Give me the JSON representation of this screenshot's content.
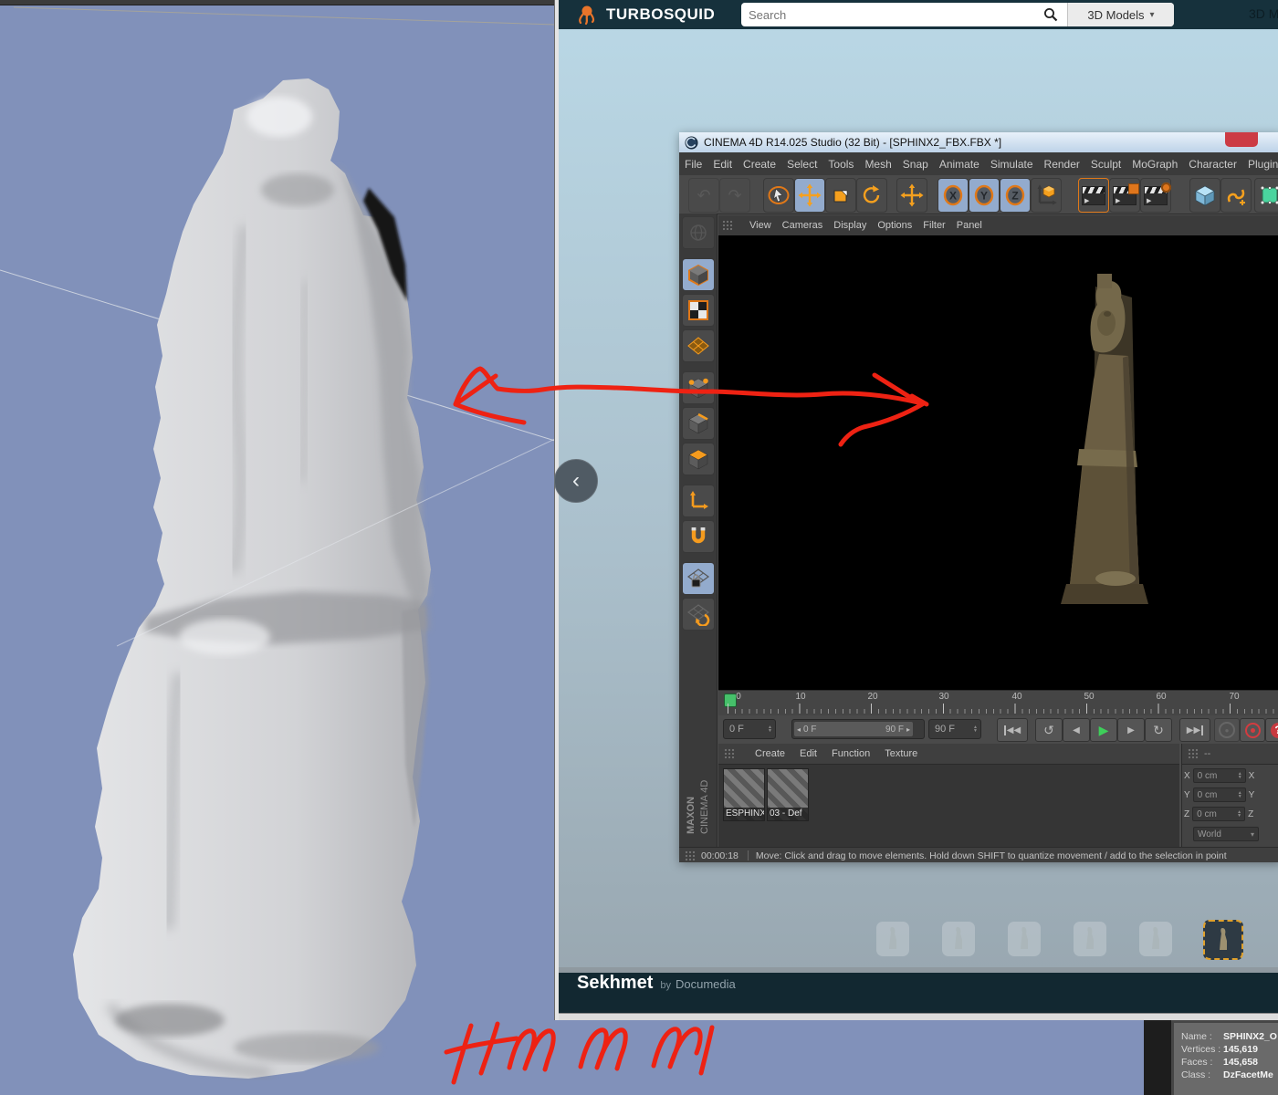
{
  "turbosquid": {
    "brand": "TURBOSQUID",
    "search_placeholder": "Search",
    "models_dropdown": "3D Models",
    "nav_right": "3D M",
    "footer": {
      "title": "Sekhmet",
      "by": "by",
      "author": "Documedia"
    }
  },
  "cinema4d": {
    "window_title": "CINEMA 4D R14.025 Studio (32 Bit) - [SPHINX2_FBX.FBX *]",
    "menu_items": [
      "File",
      "Edit",
      "Create",
      "Select",
      "Tools",
      "Mesh",
      "Snap",
      "Animate",
      "Simulate",
      "Render",
      "Sculpt",
      "MoGraph",
      "Character",
      "Plugins"
    ],
    "viewport_menu_items": [
      "View",
      "Cameras",
      "Display",
      "Options",
      "Filter",
      "Panel"
    ],
    "timeline": {
      "ticks": [
        "0",
        "10",
        "20",
        "30",
        "40",
        "50",
        "60",
        "70"
      ]
    },
    "transport": {
      "current_frame": "0 F",
      "range_start": "0 F",
      "range_end": "90 F",
      "end_frame": "90 F"
    },
    "materials": {
      "menu_items": [
        "Create",
        "Edit",
        "Function",
        "Texture"
      ],
      "items": [
        "ESPHINX",
        "03 - Def"
      ]
    },
    "coordinates": {
      "header_label": "--",
      "axes": [
        {
          "label": "X",
          "value": "0 cm"
        },
        {
          "label": "Y",
          "value": "0 cm"
        },
        {
          "label": "Z",
          "value": "0 cm"
        }
      ],
      "space": "World"
    },
    "status": {
      "time": "00:00:18",
      "message": "Move: Click and drag to move elements. Hold down SHIFT to quantize movement / add to the selection in point"
    },
    "branding": {
      "line1": "MAXON",
      "line2": "CINEMA 4D"
    }
  },
  "info_panel": {
    "rows": [
      {
        "label": "Name :",
        "value": "SPHINX2_O"
      },
      {
        "label": "Vertices :",
        "value": "145,619"
      },
      {
        "label": "Faces :",
        "value": "145,658"
      },
      {
        "label": "Class :",
        "value": "DzFacetMe"
      }
    ]
  },
  "annotations": {
    "handwritten_note": "Hmmm"
  },
  "glyphs": {
    "chevron_left": "‹",
    "caret_down": "▾",
    "help": "?"
  },
  "icons": {
    "header": [
      "octopus-logo",
      "search-icon",
      "caret-down-icon"
    ],
    "top_toolbar": [
      "undo-icon",
      "redo-icon",
      "live-selection-icon",
      "move-tool-icon",
      "scale-tool-icon",
      "rotate-tool-icon",
      "last-tool-icon",
      "x-axis-lock-icon",
      "y-axis-lock-icon",
      "z-axis-lock-icon",
      "coordinate-system-icon",
      "render-view-icon",
      "render-picture-viewer-icon",
      "render-settings-icon",
      "add-cube-icon",
      "add-spline-icon",
      "make-editable-icon"
    ],
    "left_toolbar": [
      "globe-icon",
      "model-mode-icon",
      "texture-mode-icon",
      "workplane-mode-icon",
      "points-mode-icon",
      "edges-mode-icon",
      "polygons-mode-icon",
      "axis-mode-icon",
      "snap-magnet-icon",
      "lock-workplane-icon",
      "rotate-workplane-icon"
    ],
    "transport": [
      "jump-start-icon",
      "prev-key-icon",
      "prev-frame-icon",
      "play-icon",
      "next-frame-icon",
      "next-key-icon",
      "jump-end-icon",
      "key-record-icon",
      "record-icon",
      "help-icon"
    ]
  },
  "colors": {
    "turbosquid_teal": "#16313c",
    "accent_orange": "#f59b1e",
    "annotation_red": "#ee2213",
    "play_green": "#3ecf5a",
    "viewport_blue": "#8191ba"
  }
}
